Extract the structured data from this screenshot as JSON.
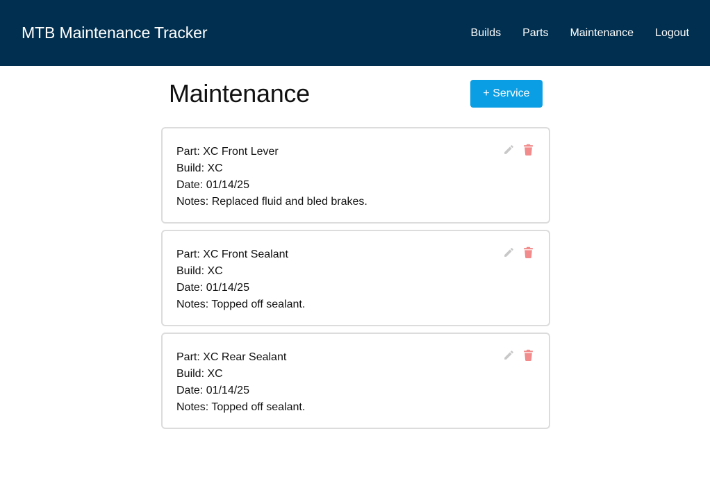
{
  "navbar": {
    "brand": "MTB Maintenance Tracker",
    "links": [
      "Builds",
      "Parts",
      "Maintenance",
      "Logout"
    ]
  },
  "page": {
    "title": "Maintenance",
    "add_button": "+ Service"
  },
  "colors": {
    "navbar_bg": "#012f4f",
    "accent": "#0a9ee4",
    "edit_icon": "#c8c8c8",
    "delete_icon": "#f28b8b"
  },
  "icons": {
    "edit": "pencil-icon",
    "delete": "trash-icon"
  },
  "records": [
    {
      "part": "Part: XC Front Lever",
      "build": "Build: XC",
      "date": "Date: 01/14/25",
      "notes": "Notes: Replaced fluid and bled brakes."
    },
    {
      "part": "Part: XC Front Sealant",
      "build": "Build: XC",
      "date": "Date: 01/14/25",
      "notes": "Notes: Topped off sealant."
    },
    {
      "part": "Part: XC Rear Sealant",
      "build": "Build: XC",
      "date": "Date: 01/14/25",
      "notes": "Notes: Topped off sealant."
    }
  ]
}
